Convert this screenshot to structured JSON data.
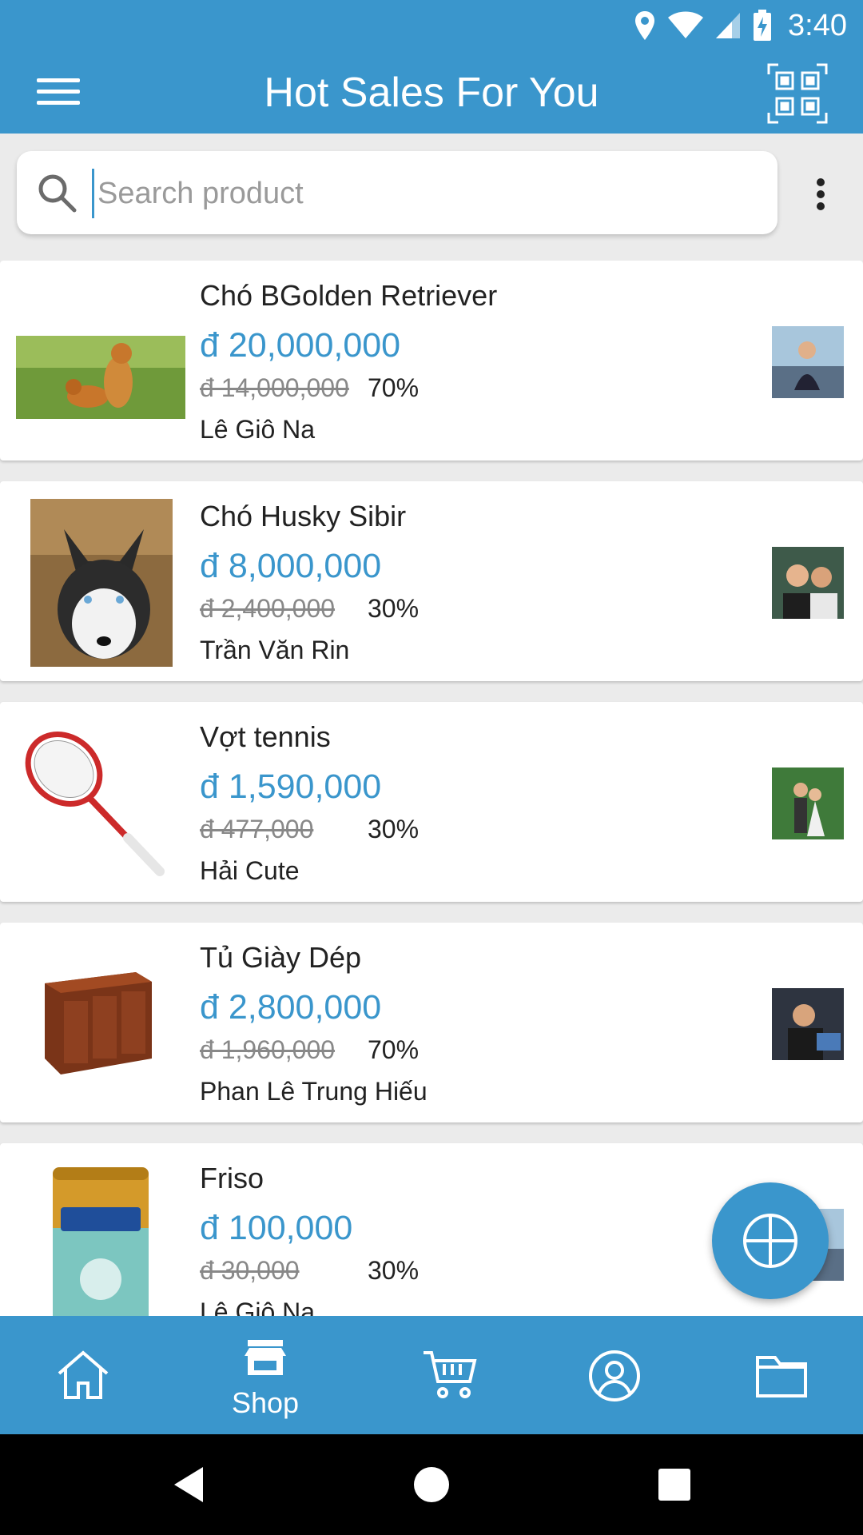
{
  "status_bar": {
    "time": "3:40"
  },
  "app_bar": {
    "title": "Hot Sales For You"
  },
  "search": {
    "placeholder": "Search product",
    "value": ""
  },
  "products": [
    {
      "name": "Chó BGolden Retriever",
      "price": "đ 20,000,000",
      "old_price": "đ 14,000,000",
      "discount": "70%",
      "seller": "Lê Giô Na"
    },
    {
      "name": "Chó Husky Sibir",
      "price": "đ 8,000,000",
      "old_price": "đ 2,400,000",
      "discount": "30%",
      "seller": "Trần Văn Rin"
    },
    {
      "name": "Vợt tennis",
      "price": "đ 1,590,000",
      "old_price": "đ 477,000",
      "discount": "30%",
      "seller": "Hải Cute"
    },
    {
      "name": "Tủ Giày Dép",
      "price": "đ 2,800,000",
      "old_price": "đ 1,960,000",
      "discount": "70%",
      "seller": "Phan Lê Trung Hiếu"
    },
    {
      "name": "Friso",
      "price": "đ 100,000",
      "old_price": "đ 30,000",
      "discount": "30%",
      "seller": "Lê Giô Na"
    }
  ],
  "bottom_nav": {
    "shop_label": "Shop"
  },
  "colors": {
    "primary": "#3a96cc"
  }
}
